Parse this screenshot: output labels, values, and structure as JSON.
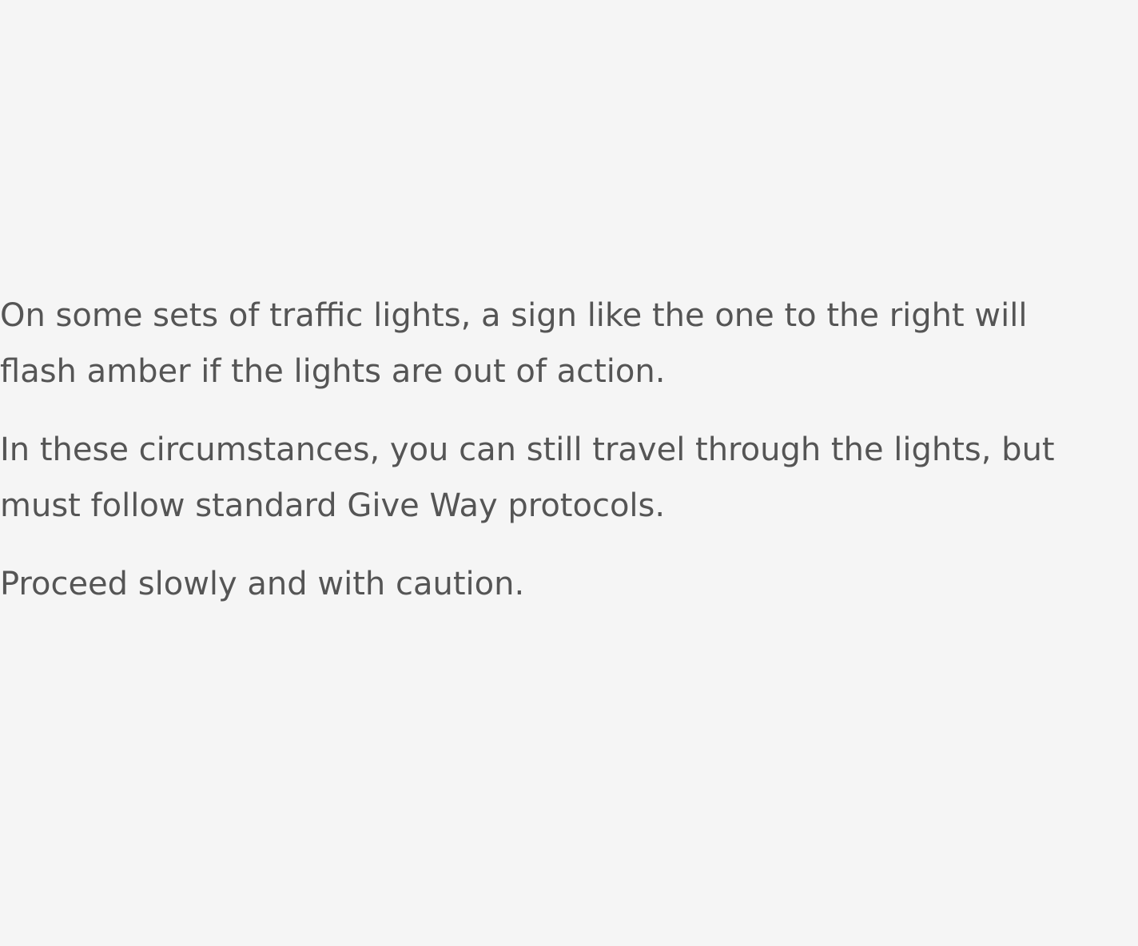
{
  "content": {
    "paragraphs": [
      "On some sets of traffic lights, a sign like the one to the right will flash amber if the lights are out of action.",
      "In these circumstances, you can still travel through the lights, but must follow standard Give Way protocols.",
      "Proceed slowly and with caution."
    ]
  },
  "colors": {
    "background": "#f5f5f5",
    "text": "#555555"
  }
}
